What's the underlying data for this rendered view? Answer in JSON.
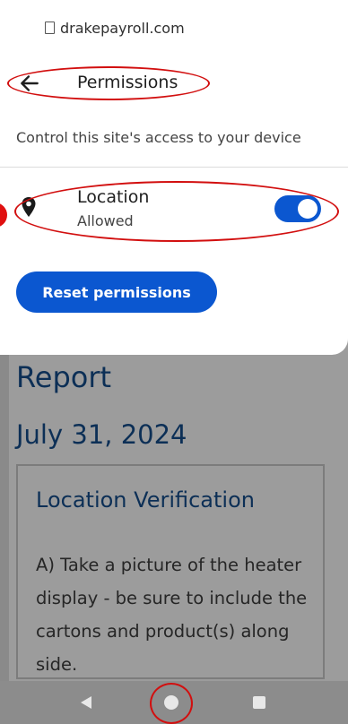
{
  "site": {
    "url": "drakepayroll.com",
    "page_icon": "page-icon"
  },
  "header": {
    "title": "Permissions",
    "back_icon": "back-arrow-icon"
  },
  "subtitle": "Control this site's access to your device",
  "location": {
    "label": "Location",
    "status": "Allowed",
    "toggle_on": true,
    "icon": "location-pin-icon"
  },
  "reset_button": {
    "label": "Reset permissions"
  },
  "background_page": {
    "title": "Report",
    "date": "July 31, 2024",
    "card": {
      "title": "Location Verification",
      "body": "A) Take a picture of the heater display - be sure to include the cartons and product(s) along side."
    }
  },
  "colors": {
    "accent": "#0b57d0",
    "annotation_red": "#d20f0f",
    "heading_navy": "#0c2f56"
  },
  "navbar": {
    "icons": [
      "back-triangle-icon",
      "home-circle-icon",
      "recents-square-icon"
    ]
  }
}
